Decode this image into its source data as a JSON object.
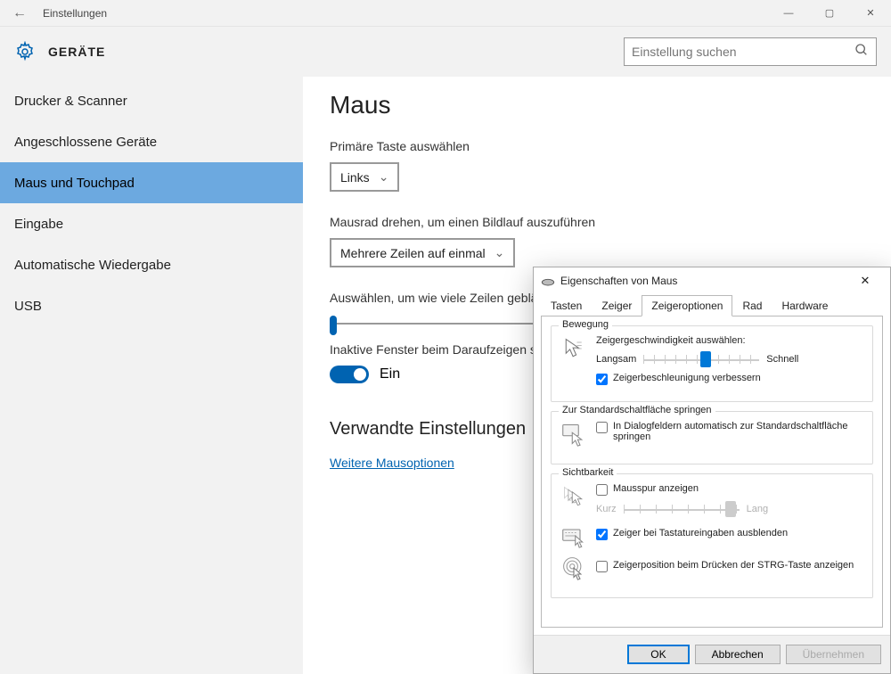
{
  "window": {
    "title": "Einstellungen"
  },
  "header": {
    "title": "GERÄTE",
    "search_placeholder": "Einstellung suchen"
  },
  "sidebar": {
    "items": [
      {
        "label": "Drucker & Scanner"
      },
      {
        "label": "Angeschlossene Geräte"
      },
      {
        "label": "Maus und Touchpad"
      },
      {
        "label": "Eingabe"
      },
      {
        "label": "Automatische Wiedergabe"
      },
      {
        "label": "USB"
      }
    ],
    "active_index": 2
  },
  "main": {
    "heading": "Maus",
    "primary_button_label": "Primäre Taste auswählen",
    "primary_button_value": "Links",
    "scroll_label": "Mausrad drehen, um einen Bildlauf auszuführen",
    "scroll_value": "Mehrere Zeilen auf einmal",
    "lines_label": "Auswählen, um wie viele Zeilen geblätte",
    "inactive_label": "Inaktive Fenster beim Daraufzeigen scro",
    "toggle_state": "Ein",
    "related_heading": "Verwandte Einstellungen",
    "related_link": "Weitere Mausoptionen"
  },
  "dialog": {
    "title": "Eigenschaften von Maus",
    "tabs": [
      "Tasten",
      "Zeiger",
      "Zeigeroptionen",
      "Rad",
      "Hardware"
    ],
    "active_tab": 2,
    "motion": {
      "legend": "Bewegung",
      "speed_label": "Zeigergeschwindigkeit auswählen:",
      "slow": "Langsam",
      "fast": "Schnell",
      "enhance": "Zeigerbeschleunigung verbessern",
      "enhance_checked": true
    },
    "snap": {
      "legend": "Zur Standardschaltfläche springen",
      "label": "In Dialogfeldern automatisch zur Standardschaltfläche springen",
      "checked": false
    },
    "visibility": {
      "legend": "Sichtbarkeit",
      "trails_label": "Mausspur anzeigen",
      "trails_checked": false,
      "short": "Kurz",
      "long": "Lang",
      "hide_typing": "Zeiger bei Tastatureingaben ausblenden",
      "hide_typing_checked": true,
      "ctrl_locate": "Zeigerposition beim Drücken der STRG-Taste anzeigen",
      "ctrl_locate_checked": false
    },
    "buttons": {
      "ok": "OK",
      "cancel": "Abbrechen",
      "apply": "Übernehmen"
    }
  }
}
